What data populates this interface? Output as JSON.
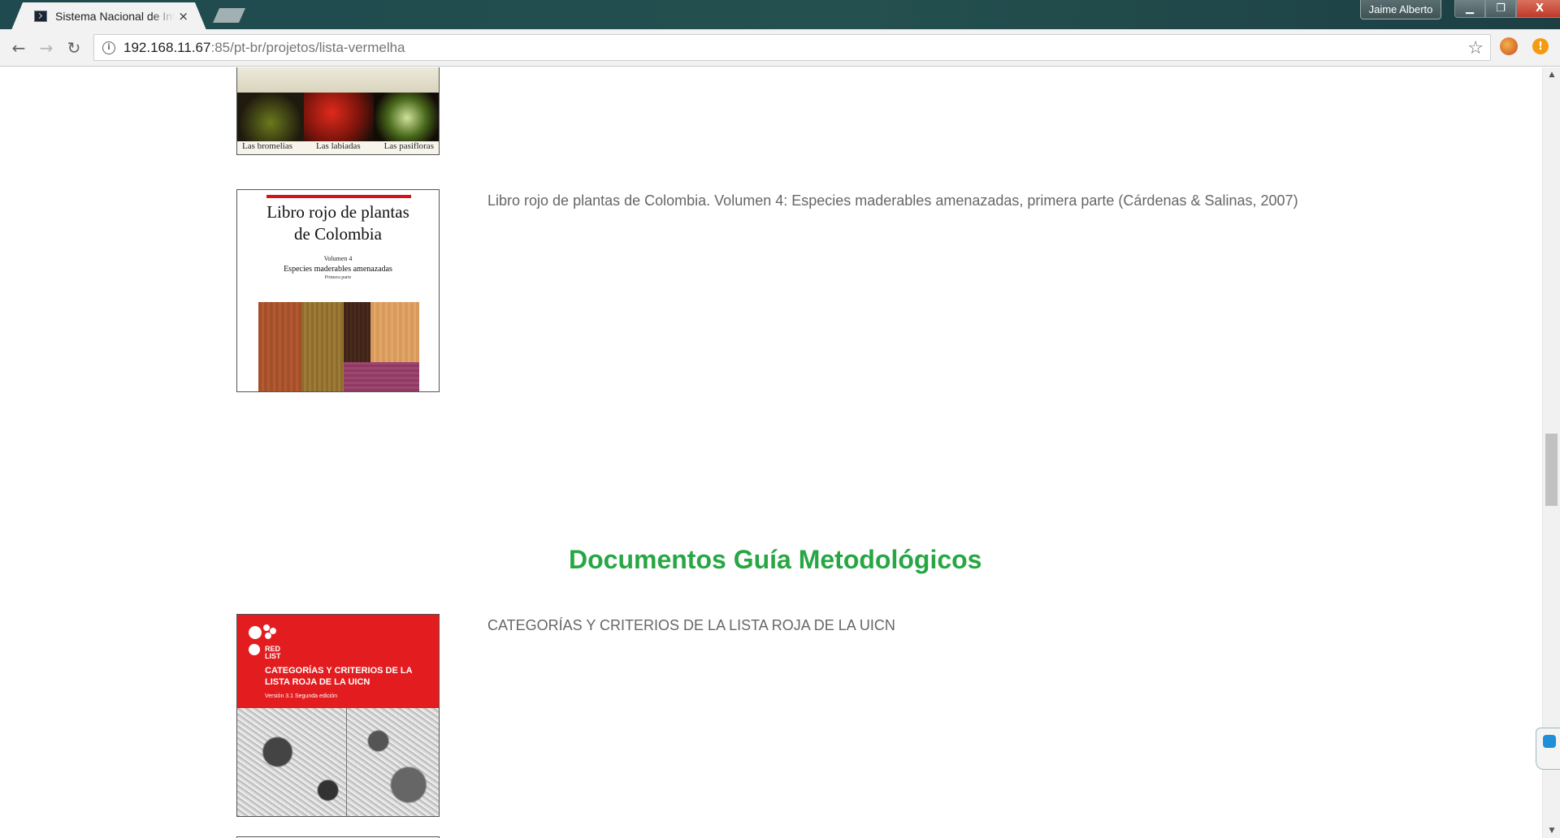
{
  "browser": {
    "tab_title": "Sistema Nacional de Información",
    "tab_close": "×",
    "profile_name": "Jaime Alberto",
    "window_controls": {
      "minimize": "▁",
      "maximize": "❐",
      "close": "X"
    },
    "url_host": "192.168.11.67",
    "url_rest": ":85/pt-br/projetos/lista-vermelha",
    "back": "←",
    "forward": "→",
    "reload": "↻",
    "info": "i",
    "star": "☆",
    "ext_alert": "!"
  },
  "page": {
    "documents_top": [
      {
        "cover_captions": [
          "Las bromelias",
          "Las labiadas",
          "Las pasifloras"
        ]
      },
      {
        "cover": {
          "title_line1": "Libro rojo de plantas",
          "title_line2": "de Colombia",
          "volume": "Volumen 4",
          "subtitle": "Especies maderables amenazadas",
          "part": "Primera parte"
        },
        "title": "Libro rojo de plantas de Colombia. Volumen 4: Especies maderables amenazadas, primera parte (Cárdenas & Salinas, 2007)"
      }
    ],
    "section_title": "Documentos Guía Metodológicos",
    "documents_guide": [
      {
        "cover": {
          "red_list_line1": "RED",
          "red_list_line2": "LIST",
          "title": "CATEGORÍAS Y CRITERIOS DE LA LISTA ROJA DE LA UICN",
          "version": "Versión 3.1 Segunda edición"
        },
        "title": "CATEGORÍAS Y CRITERIOS DE LA LISTA ROJA DE LA UICN"
      }
    ]
  },
  "colors": {
    "section_title": "#27a744",
    "doc_title": "#666666",
    "iucn_red": "#e31c1f"
  }
}
